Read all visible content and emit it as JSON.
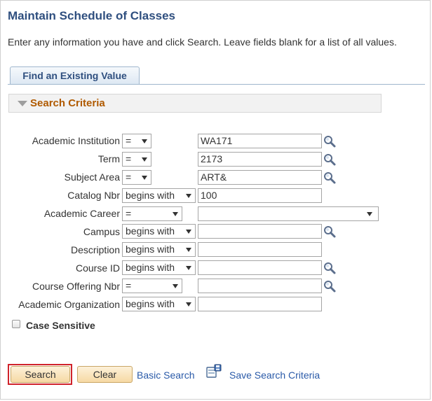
{
  "page": {
    "title": "Maintain Schedule of Classes",
    "instructions": "Enter any information you have and click Search. Leave fields blank for a list of all values."
  },
  "tab": {
    "label": "Find an Existing Value"
  },
  "search_criteria": {
    "header": "Search Criteria",
    "fields": [
      {
        "label": "Academic Institution",
        "operator": "=",
        "value": "WA171",
        "has_lookup": true
      },
      {
        "label": "Term",
        "operator": "=",
        "value": "2173",
        "has_lookup": true
      },
      {
        "label": "Subject Area",
        "operator": "=",
        "value": "ART&",
        "has_lookup": true
      },
      {
        "label": "Catalog Nbr",
        "operator": "begins with",
        "value": "100",
        "has_lookup": false
      },
      {
        "label": "Academic Career",
        "operator": "=",
        "value": "",
        "has_lookup": false,
        "is_dropdown": true
      },
      {
        "label": "Campus",
        "operator": "begins with",
        "value": "",
        "has_lookup": true
      },
      {
        "label": "Description",
        "operator": "begins with",
        "value": "",
        "has_lookup": false
      },
      {
        "label": "Course ID",
        "operator": "begins with",
        "value": "",
        "has_lookup": true
      },
      {
        "label": "Course Offering Nbr",
        "operator": "=",
        "value": "",
        "has_lookup": true
      },
      {
        "label": "Academic Organization",
        "operator": "begins with",
        "value": "",
        "has_lookup": false
      }
    ],
    "case_sensitive": {
      "label": "Case Sensitive",
      "checked": false
    }
  },
  "actions": {
    "search_label": "Search",
    "clear_label": "Clear",
    "basic_search_label": "Basic Search",
    "save_search_label": "Save Search Criteria"
  },
  "colors": {
    "title": "#2f4f7f",
    "header_accent": "#b05a00",
    "button_bg": "#f6d9a4",
    "link": "#2a5aa8",
    "highlight": "#d0232b"
  },
  "icons": {
    "lookup": "magnifier-icon",
    "save_search": "save-search-icon",
    "collapse": "triangle-down-icon"
  }
}
